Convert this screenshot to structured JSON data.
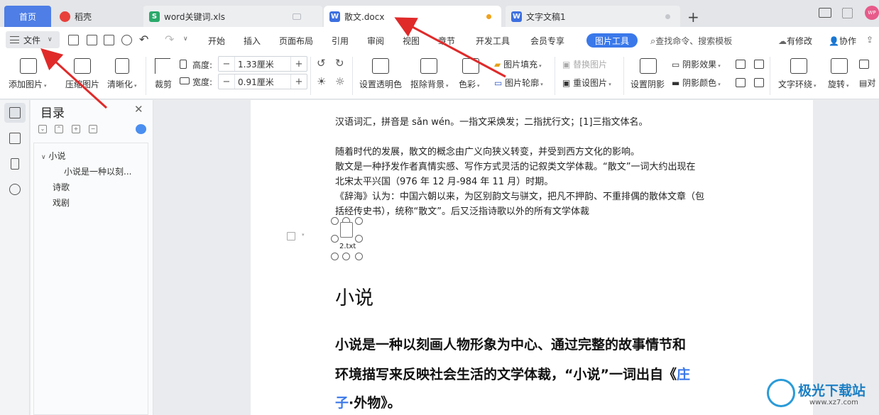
{
  "tabs": {
    "home": "首页",
    "daoke": "稻壳",
    "xls": "word关键词.xls",
    "active": "散文.docx",
    "doc1": "文字文稿1",
    "add": "+",
    "avatar": "WP"
  },
  "menubar": {
    "file": "文件",
    "items": [
      "开始",
      "插入",
      "页面布局",
      "引用",
      "审阅",
      "视图",
      "章节",
      "开发工具",
      "会员专享"
    ],
    "picture_tools": "图片工具",
    "search": "查找命令、搜索模板",
    "has_changes": "有修改",
    "collaborate": "协作"
  },
  "ribbon": {
    "add_picture": "添加图片",
    "compress": "压缩图片",
    "sharpen": "清晰化",
    "crop": "裁剪",
    "height_label": "高度:",
    "height_value": "1.33厘米",
    "width_label": "宽度:",
    "width_value": "0.91厘米",
    "set_transparent": "设置透明色",
    "remove_bg": "抠除背景",
    "color": "色彩",
    "fill": "图片填充",
    "outline": "图片轮廓",
    "replace": "替换图片",
    "reset": "重设图片",
    "set_shadow": "设置阴影",
    "shadow_effect": "阴影效果",
    "shadow_color": "阴影颜色",
    "text_wrap": "文字环绕",
    "rotate": "旋转",
    "align_partial": "对"
  },
  "toc": {
    "title": "目录",
    "items": [
      {
        "label": "小说"
      },
      {
        "label": "小说是一种以刻..."
      },
      {
        "label": "诗歌"
      },
      {
        "label": "戏剧"
      }
    ]
  },
  "doc": {
    "line1": "汉语词汇，拼音是 sǎn wén。一指文采焕发；二指扰行文；[1]三指文体名。",
    "line2": "随着时代的发展，散文的概念由广义向狭义转变，并受到西方文化的影响。",
    "line3": "散文是一种抒发作者真情实感、写作方式灵活的记叙类文学体裁。“散文”一词大约出现在",
    "line4": "北宋太平兴国（976 年 12 月-984 年 11 月）时期。",
    "line5": "《辞海》认为：中国六朝以来，为区别韵文与骈文，把凡不押韵、不重排偶的散体文章（包",
    "line6": "括经传史书），统称“散文”。后又泛指诗歌以外的所有文学体裁",
    "object_label": "2.txt",
    "heading": "小说",
    "bold1": "小说是一种以刻画人物形象为中心、通过完整的故事情节和",
    "bold2a": "环境描写来反映社会生活的文学体裁，“小说”一词出自《",
    "bold2b": "庄",
    "bold3a": "子",
    "bold3b": "·外物》。"
  },
  "watermark": {
    "name": "极光下载站",
    "url": "www.xz7.com"
  },
  "colors": {
    "accent": "#3a78ea",
    "arrow": "#e02a2a"
  }
}
